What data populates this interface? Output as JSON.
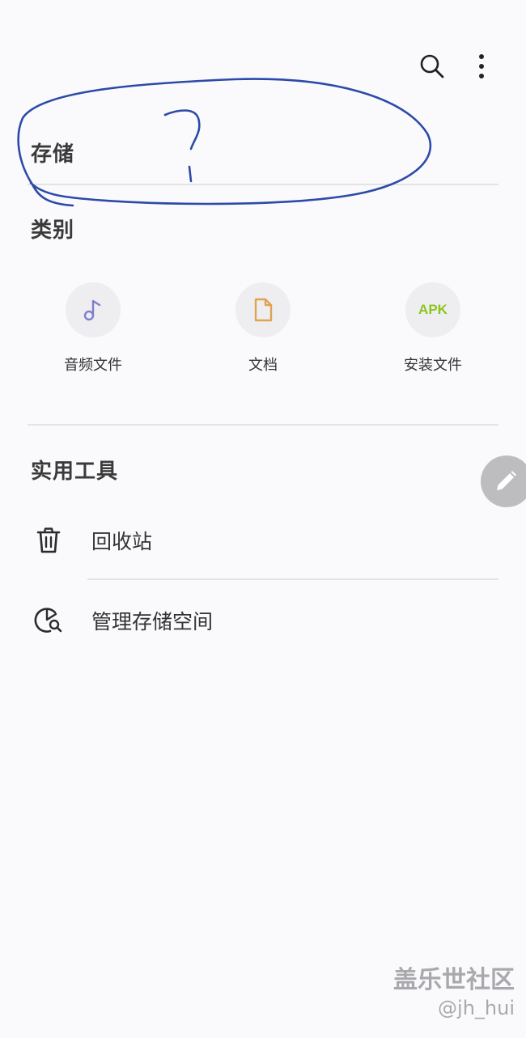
{
  "header": {
    "search_icon": "search-icon",
    "more_icon": "more-vertical-icon"
  },
  "storage": {
    "title": "存储",
    "annotation_text": "?"
  },
  "categories": {
    "title": "类别",
    "items": [
      {
        "label": "音频文件",
        "icon": "music-note-icon",
        "color": "#7d7fd0"
      },
      {
        "label": "文档",
        "icon": "document-icon",
        "color": "#e2a24f"
      },
      {
        "label": "安装文件",
        "icon": "apk-icon",
        "icon_text": "APK",
        "color": "#8dc41e"
      }
    ]
  },
  "tools": {
    "title": "实用工具",
    "items": [
      {
        "label": "回收站",
        "icon": "trash-icon"
      },
      {
        "label": "管理存储空间",
        "icon": "storage-manage-icon"
      }
    ]
  },
  "fab": {
    "icon": "pencil-icon"
  },
  "watermark": {
    "brand": "盖乐世社区",
    "user": "@jh_hui"
  },
  "colors": {
    "background": "#fafafc",
    "annotation": "#2c4aa8"
  }
}
